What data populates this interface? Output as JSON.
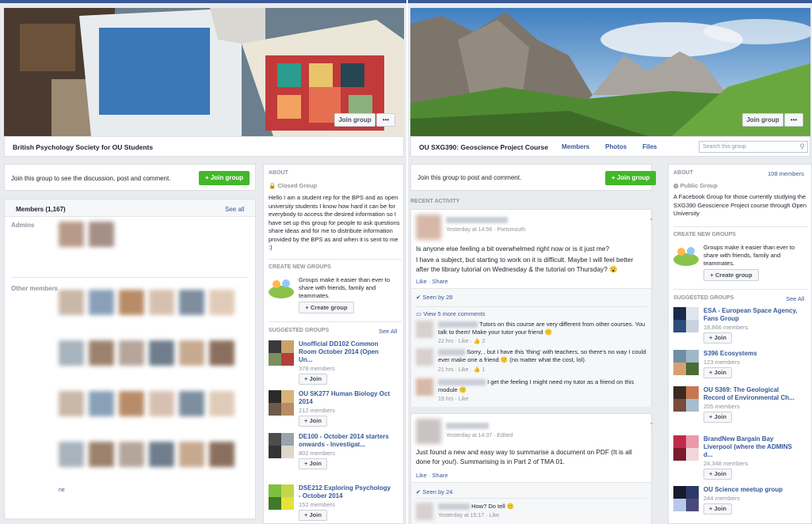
{
  "left": {
    "group_name": "British Psychology Society for OU Students",
    "join_group_cover": "Join group",
    "more_dots": "•••",
    "join_prompt": "Join this group to see the discussion, post and comment.",
    "join_button": "+ Join group",
    "members_title": "Members (1,167)",
    "see_all": "See all",
    "admins_label": "Admins",
    "other_members_label": "Other members",
    "about_header": "ABOUT",
    "privacy": "Closed Group",
    "about_text": "Hello I am a student rep for the BPS and as open university students I know how hard it can be for everybody to access the desired information so I have set up this group for people to ask questions share ideas and for me to distribute information provided by the BPS as and when it is sent to me :)",
    "create_header": "CREATE NEW GROUPS",
    "create_text": "Groups make it easier than ever to share with friends, family and teammates.",
    "create_button": "+ Create group",
    "suggested_header": "SUGGESTED GROUPS",
    "suggested_see_all": "See All",
    "suggested": [
      {
        "name": "Unofficial DD102 Common Room October 2014 (Open Un...",
        "members": "378 members",
        "join": "+ Join"
      },
      {
        "name": "OU SK277 Human Biology Oct 2014",
        "members": "212 members",
        "join": "+ Join"
      },
      {
        "name": "DE100 - October 2014 starters onwards - Investigat...",
        "members": "802 members",
        "join": "+ Join"
      },
      {
        "name": "DSE212 Exploring Psychology - October 2014",
        "members": "152 members",
        "join": "+ Join"
      }
    ],
    "stray_text": "ne"
  },
  "right": {
    "group_name": "OU SXG390: Geoscience Project Course",
    "tabs": [
      "Members",
      "Photos",
      "Files"
    ],
    "search_placeholder": "Search this group",
    "join_group_cover": "Join group",
    "more_dots": "•••",
    "join_prompt": "Join this group to post and comment.",
    "join_button": "+ Join group",
    "recent_activity": "RECENT ACTIVITY",
    "post1": {
      "meta": "Yesterday at 14:56 · Portsmouth",
      "text1": "Is anyone else feeling a bit overwhelmed right now or is it just me?",
      "text2": "I have a subject, but starting to work on it is difficult. Maybe I will feel better after the library tutorial on Wednesday & the tutorial on Thursday? 😮",
      "actions": "Like · Share",
      "seen": "Seen by 28",
      "more_comments": "View 5 more comments",
      "comments": [
        {
          "text": "Tutors on this course are very different from other courses. You talk to them! Make your tutor your friend 🙂",
          "meta": "22 hrs · Like · 👍 2"
        },
        {
          "text": "Sorry, , but I have this 'thing' with teachers, so there's no way I could ever make one a friend 🙁 (no matter what the cost, lol).",
          "meta": "21 hrs · Like · 👍 1"
        },
        {
          "text": "I get the feeling I might need my tutor as a friend on this module 🙂",
          "meta": "19 hrs · Like"
        }
      ]
    },
    "post2": {
      "meta": "Yesterday at 14:37 · Edited",
      "text": "Just found a new and easy way to summarise a document on PDF (It is all done for you!). Summarising is in Part 2 of TMA 01.",
      "actions": "Like · Share",
      "seen": "Seen by 24",
      "comment": {
        "text": "How? Do tell 🙂",
        "meta": "Yesterday at 15:17 · Like"
      }
    },
    "about_header": "ABOUT",
    "about_members": "108 members",
    "privacy": "Public Group",
    "about_text": "A Facebook Group for those currently studying the SXG390 Geoscience Project course through Open University",
    "create_header": "CREATE NEW GROUPS",
    "create_text": "Groups make it easier than ever to share with friends, family and teammates.",
    "create_button": "+ Create group",
    "suggested_header": "SUGGESTED GROUPS",
    "suggested_see_all": "See All",
    "suggested": [
      {
        "name": "ESA - European Space Agency, Fans Group",
        "members": "18,866 members",
        "join": "+ Join"
      },
      {
        "name": "S396 Ecosystems",
        "members": "123 members",
        "join": "+ Join"
      },
      {
        "name": "OU S369: The Geological Record of Environmental Ch...",
        "members": "205 members",
        "join": "+ Join"
      },
      {
        "name": "BrandNew Bargain Bay Liverpool (where the ADMINS d...",
        "members": "24,348 members",
        "join": "+ Join"
      },
      {
        "name": "OU Science meetup group",
        "members": "244 members",
        "join": "+ Join"
      }
    ]
  },
  "colors": {
    "brand": "#3b5998",
    "link": "#365899",
    "join_green": "#42b72a",
    "page_bg": "#e9ebee"
  }
}
